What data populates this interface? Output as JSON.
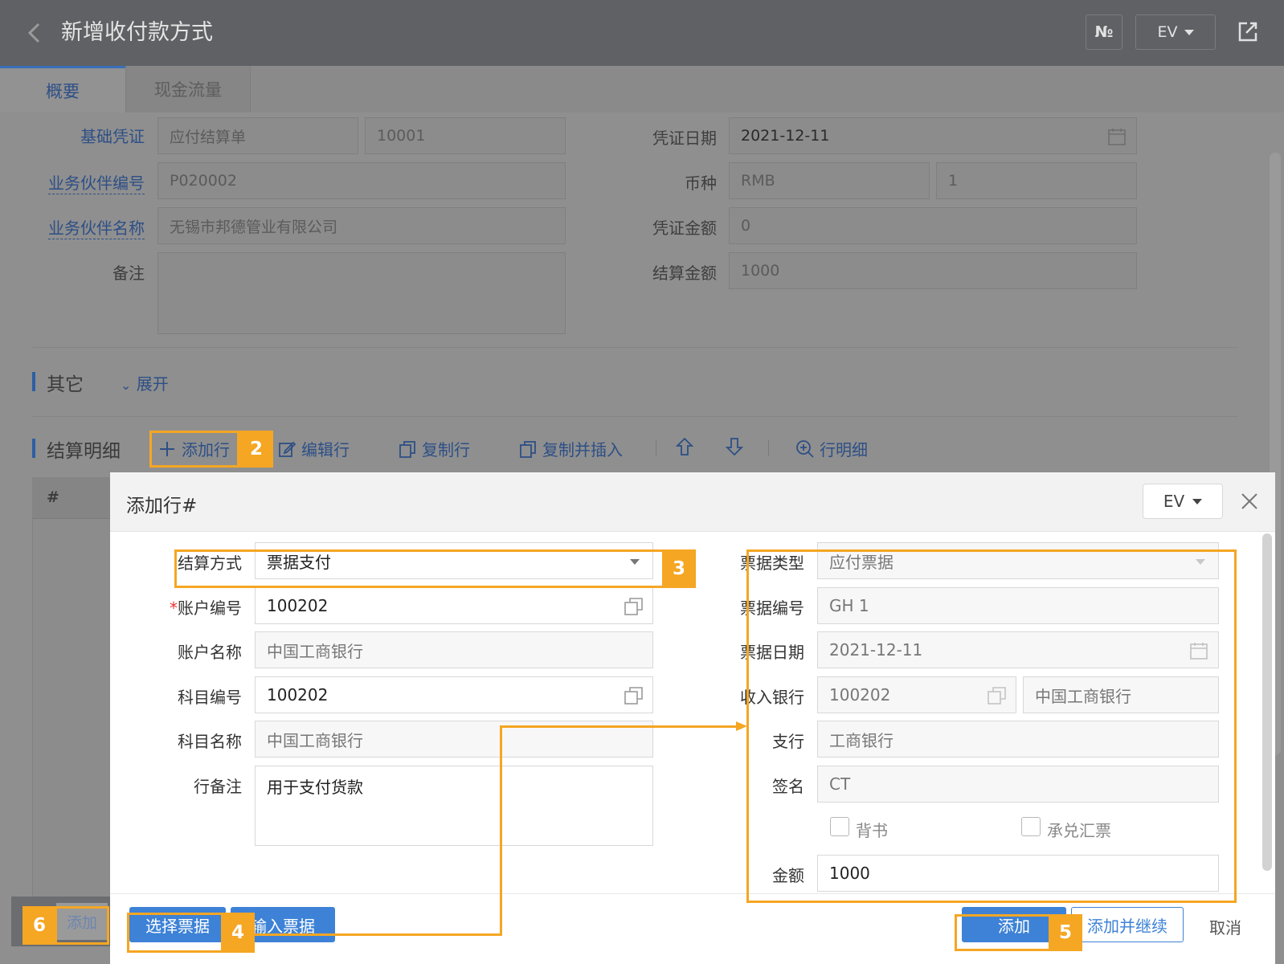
{
  "header": {
    "title": "新增收付款方式",
    "no_button": "№",
    "lang_button": "EV"
  },
  "tabs": [
    {
      "label": "概要"
    },
    {
      "label": "现金流量"
    }
  ],
  "form": {
    "base_voucher_label": "基础凭证",
    "base_voucher_type": "应付结算单",
    "base_voucher_no": "10001",
    "partner_code_label": "业务伙伴编号",
    "partner_code": "P020002",
    "partner_name_label": "业务伙伴名称",
    "partner_name": "无锡市邦德管业有限公司",
    "remark_label": "备注",
    "remark": "",
    "voucher_date_label": "凭证日期",
    "voucher_date": "2021-12-11",
    "currency_label": "币种",
    "currency": "RMB",
    "rate": "1",
    "voucher_amount_label": "凭证金额",
    "voucher_amount": "0",
    "settle_amount_label": "结算金额",
    "settle_amount": "1000"
  },
  "other_section": {
    "title": "其它",
    "expand": "展开"
  },
  "detail_section": {
    "title": "结算明细",
    "toolbar": {
      "add_row": "添加行",
      "edit_row": "编辑行",
      "copy_row": "复制行",
      "copy_insert": "复制并插入",
      "row_detail": "行明细"
    },
    "grid_header": "#",
    "add_button": "添加"
  },
  "dialog": {
    "title": "添加行#",
    "lang_button": "EV",
    "left": {
      "settle_method_label": "结算方式",
      "settle_method": "票据支付",
      "account_no_label": "账户编号",
      "account_no": "100202",
      "account_name_label": "账户名称",
      "account_name": "中国工商银行",
      "subject_no_label": "科目编号",
      "subject_no": "100202",
      "subject_name_label": "科目名称",
      "subject_name": "中国工商银行",
      "row_remark_label": "行备注",
      "row_remark": "用于支付货款"
    },
    "right": {
      "bill_type_label": "票据类型",
      "bill_type": "应付票据",
      "bill_no_label": "票据编号",
      "bill_no": "GH 1",
      "bill_date_label": "票据日期",
      "bill_date": "2021-12-11",
      "income_bank_label": "收入银行",
      "income_bank_code": "100202",
      "income_bank_name": "中国工商银行",
      "branch_label": "支行",
      "branch": "工商银行",
      "sign_label": "签名",
      "sign": "CT",
      "endorse_label": "背书",
      "accept_label": "承兑汇票",
      "amount_label": "金额",
      "amount": "1000"
    },
    "footer": {
      "select_bill": "选择票据",
      "input_bill": "输入票据",
      "add": "添加",
      "add_continue": "添加并继续",
      "cancel": "取消"
    }
  },
  "annotations": {
    "step2": "2",
    "step3": "3",
    "step4": "4",
    "step5": "5",
    "step6": "6"
  },
  "colors": {
    "accent": "#3d82d6",
    "highlight": "#f5a623",
    "header_bg": "#5f6164"
  }
}
